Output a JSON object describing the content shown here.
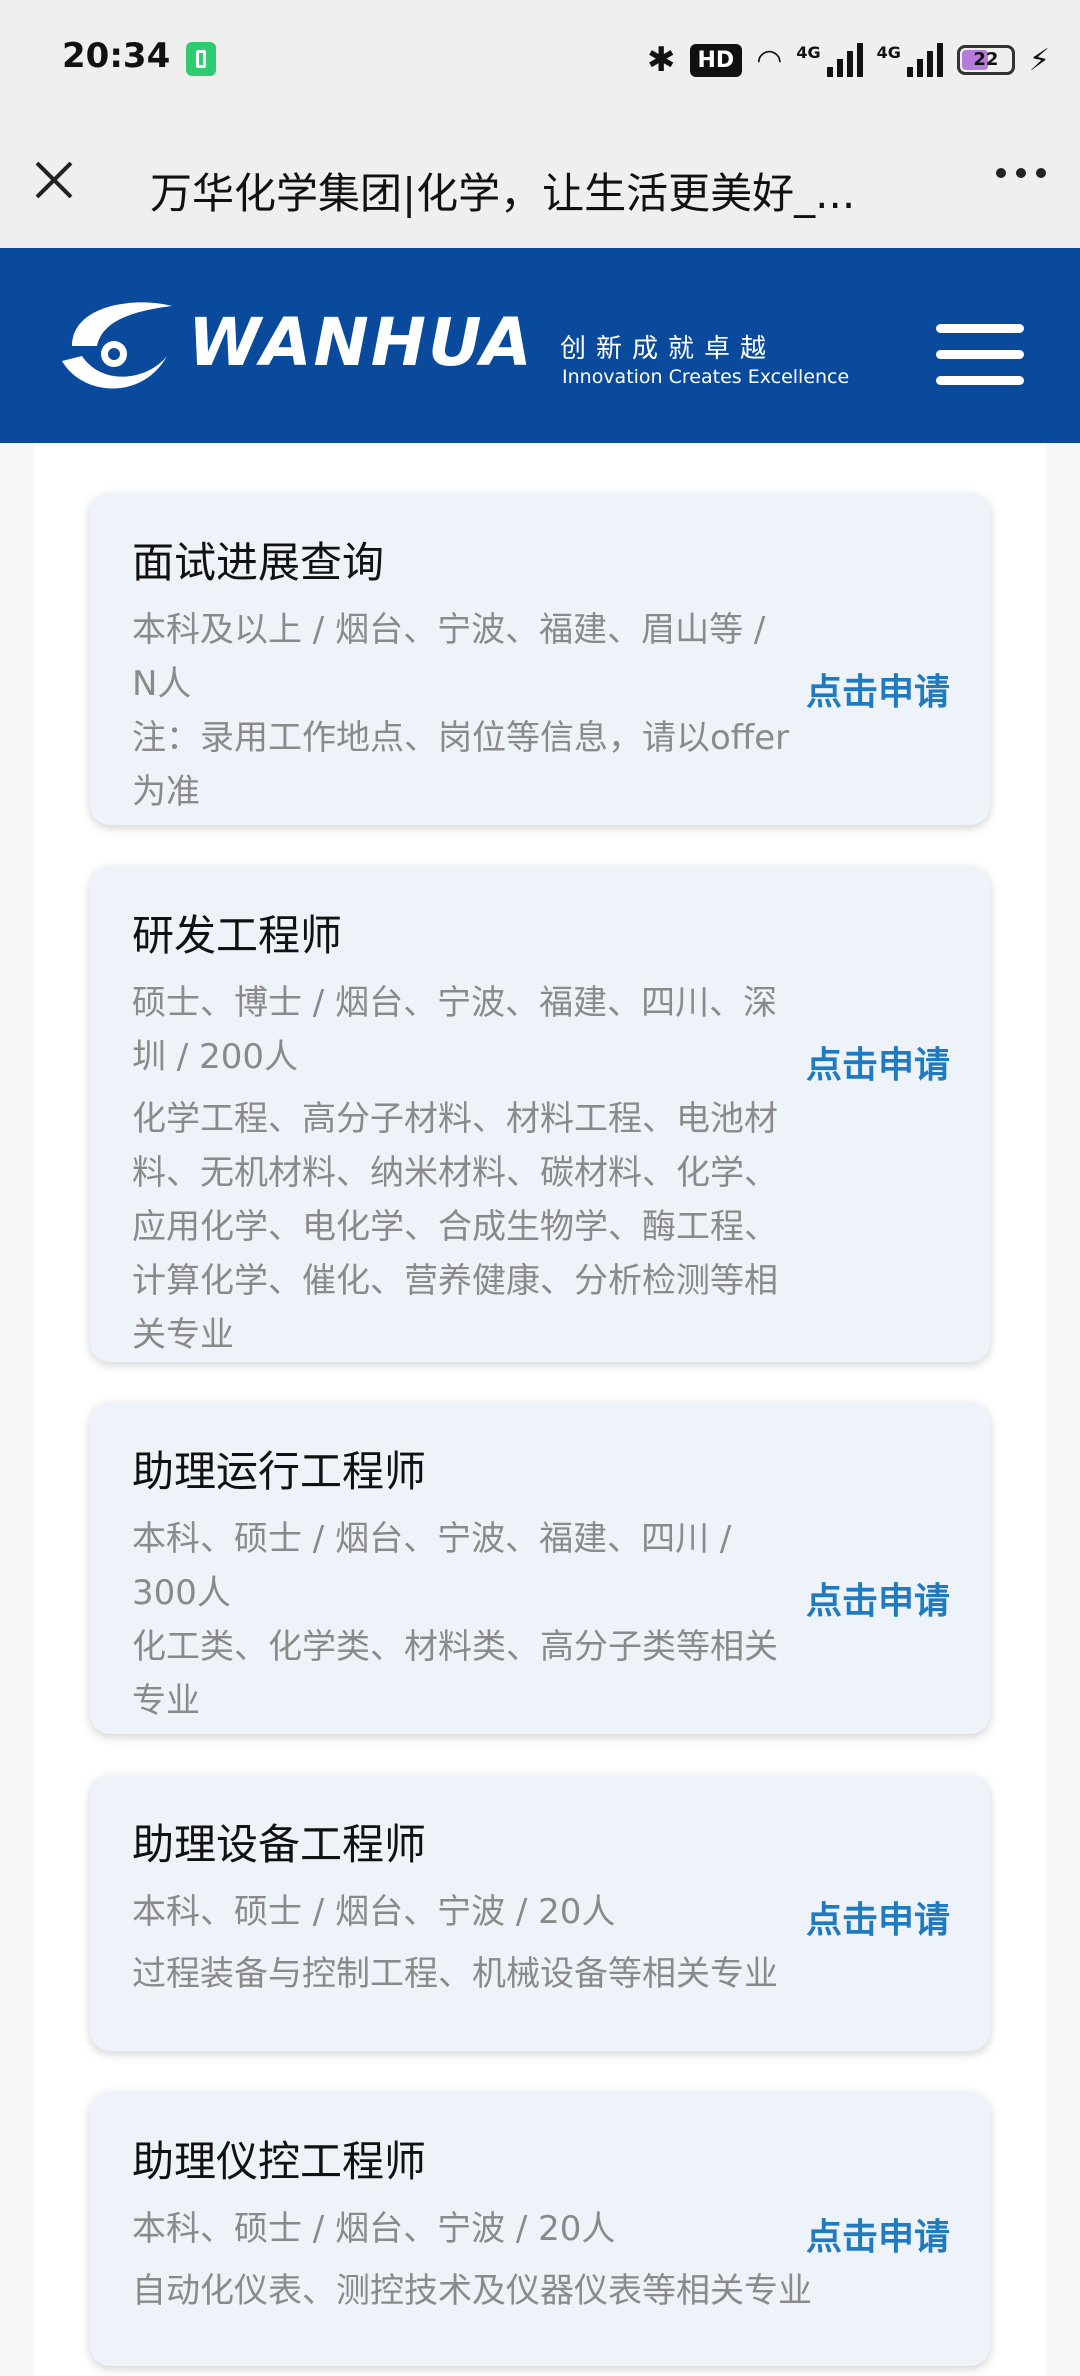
{
  "status_bar": {
    "time": "20:34",
    "hd": "HD",
    "network_1": "4G",
    "network_2": "4G",
    "battery": "22"
  },
  "browser": {
    "title": "万华化学集团|化学，让生活更美好_..."
  },
  "header": {
    "brand": "WANHUA",
    "slogan_cn": "创新成就卓越",
    "slogan_en": "Innovation Creates Excellence"
  },
  "jobs": [
    {
      "title": "面试进展查询",
      "lines": [
        "本科及以上 / 烟台、宁波、福建、眉山等 / N人",
        "注：录用工作地点、岗位等信息，请以offer为准"
      ],
      "apply": "点击申请"
    },
    {
      "title": "研发工程师",
      "lines": [
        "硕士、博士 / 烟台、宁波、福建、四川、深圳 / 200人",
        "化学工程、高分子材料、材料工程、电池材料、无机材料、纳米材料、碳材料、化学、应用化学、电化学、合成生物学、酶工程、计算化学、催化、营养健康、分析检测等相关专业"
      ],
      "apply": "点击申请"
    },
    {
      "title": "助理运行工程师",
      "lines": [
        "本科、硕士 / 烟台、宁波、福建、四川 / 300人",
        "化工类、化学类、材料类、高分子类等相关专业"
      ],
      "apply": "点击申请"
    },
    {
      "title": "助理设备工程师",
      "lines": [
        "本科、硕士 / 烟台、宁波 / 20人",
        "过程装备与控制工程、机械设备等相关专业"
      ],
      "apply": "点击申请"
    },
    {
      "title": "助理仪控工程师",
      "lines": [
        "本科、硕士 / 烟台、宁波 / 20人",
        "自动化仪表、测控技术及仪器仪表等相关专业"
      ],
      "apply": "点击申请"
    }
  ]
}
